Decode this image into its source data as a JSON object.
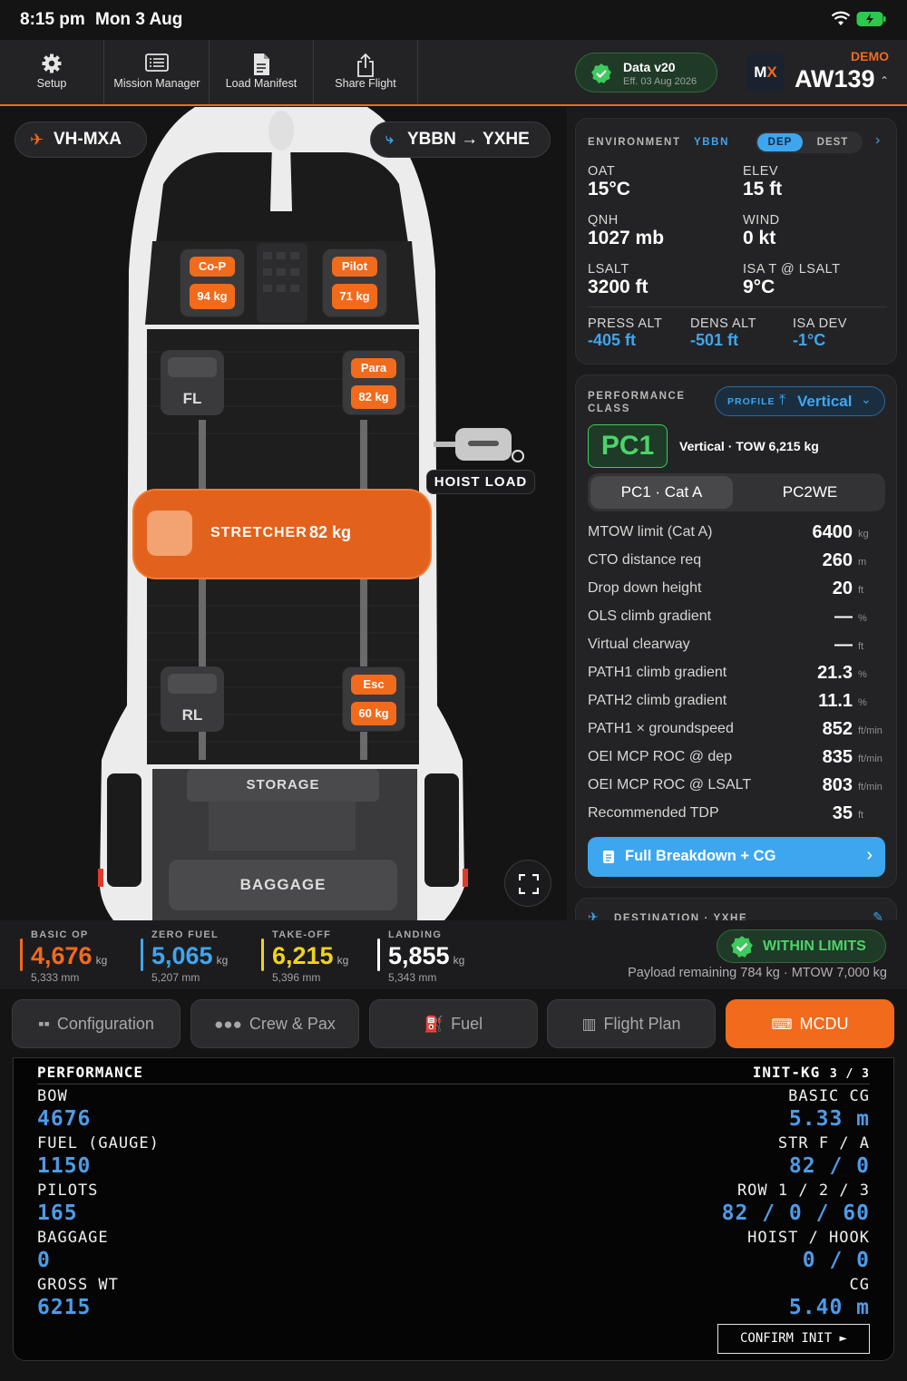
{
  "status": {
    "time": "8:15 pm",
    "date": "Mon 3 Aug"
  },
  "toolbar": {
    "buttons": [
      "Setup",
      "Mission Manager",
      "Load Manifest",
      "Share Flight"
    ],
    "data_version": "Data v20",
    "data_effective": "Eff. 03 Aug 2026",
    "logo_m": "M",
    "logo_x": "X",
    "demo": "DEMO",
    "aircraft": "AW139"
  },
  "heli": {
    "registration": "VH-MXA",
    "route": "YBBN → YXHE",
    "seats": {
      "copilot_label": "Co-P",
      "copilot_weight": "94 kg",
      "pilot_label": "Pilot",
      "pilot_weight": "71 kg",
      "fl_label": "FL",
      "para_label": "Para",
      "para_weight": "82 kg",
      "rl_label": "RL",
      "esc_label": "Esc",
      "esc_weight": "60 kg"
    },
    "hoist_label": "HOIST LOAD",
    "stretcher_label": "STRETCHER",
    "stretcher_weight": "82 kg",
    "storage_label": "STORAGE",
    "baggage_label": "BAGGAGE"
  },
  "environment": {
    "title": "ENVIRONMENT",
    "airport": "YBBN",
    "tab_dep": "DEP",
    "tab_dest": "DEST",
    "oat_label": "OAT",
    "oat": "15°C",
    "elev_label": "ELEV",
    "elev": "15 ft",
    "qnh_label": "QNH",
    "qnh": "1027 mb",
    "wind_label": "WIND",
    "wind": "0 kt",
    "lsalt_label": "LSALT",
    "lsalt": "3200 ft",
    "isa_label": "ISA T @ LSALT",
    "isa": "9°C",
    "press_label": "PRESS ALT",
    "press": "-405 ft",
    "dens_label": "DENS ALT",
    "dens": "-501 ft",
    "isadev_label": "ISA DEV",
    "isadev": "-1°C"
  },
  "performance": {
    "title_1": "PERFORMANCE",
    "title_2": "CLASS",
    "profile_label": "PROFILE",
    "profile_value": "Vertical",
    "class_badge": "PC1",
    "class_desc": "Vertical · TOW 6,215 kg",
    "seg_a": "PC1 · Cat A",
    "seg_b": "PC2WE",
    "rows": [
      {
        "label": "MTOW limit (Cat A)",
        "value": "6400",
        "unit": "kg"
      },
      {
        "label": "CTO distance req",
        "value": "260",
        "unit": "m"
      },
      {
        "label": "Drop down height",
        "value": "20",
        "unit": "ft"
      },
      {
        "label": "OLS climb gradient",
        "value": "—",
        "unit": "%"
      },
      {
        "label": "Virtual clearway",
        "value": "—",
        "unit": "ft"
      },
      {
        "label": "PATH1 climb gradient",
        "value": "21.3",
        "unit": "%"
      },
      {
        "label": "PATH2 climb gradient",
        "value": "11.1",
        "unit": "%"
      },
      {
        "label": "PATH1 × groundspeed",
        "value": "852",
        "unit": "ft/min"
      },
      {
        "label": "OEI MCP ROC @ dep",
        "value": "835",
        "unit": "ft/min"
      },
      {
        "label": "OEI MCP ROC @ LSALT",
        "value": "803",
        "unit": "ft/min"
      },
      {
        "label": "Recommended TDP",
        "value": "35",
        "unit": "ft"
      }
    ],
    "breakdown_button": "Full Breakdown + CG"
  },
  "destination_peek": "DESTINATION · YXHE",
  "weights": [
    {
      "label": "BASIC OP",
      "value": "4,676",
      "unit": "kg",
      "arm": "5,333 mm",
      "color": "#f26a1c"
    },
    {
      "label": "ZERO FUEL",
      "value": "5,065",
      "unit": "kg",
      "arm": "5,207 mm",
      "color": "#3ea6ef"
    },
    {
      "label": "TAKE-OFF",
      "value": "6,215",
      "unit": "kg",
      "arm": "5,396 mm",
      "color": "#f2d21c"
    },
    {
      "label": "LANDING",
      "value": "5,855",
      "unit": "kg",
      "arm": "5,343 mm",
      "color": "#ffffff"
    }
  ],
  "limits": {
    "status": "WITHIN LIMITS",
    "payload": "Payload remaining 784 kg · MTOW 7,000 kg"
  },
  "tabs": [
    "Configuration",
    "Crew & Pax",
    "Fuel",
    "Flight Plan",
    "MCDU"
  ],
  "mcdu": {
    "title": "PERFORMANCE",
    "page": "INIT-KG",
    "page_num": "3 / 3",
    "left": [
      {
        "key": "BOW",
        "val": "4676"
      },
      {
        "key": "FUEL (GAUGE)",
        "val": "1150"
      },
      {
        "key": "PILOTS",
        "val": "165"
      },
      {
        "key": "BAGGAGE",
        "val": "0"
      },
      {
        "key": "GROSS WT",
        "val": "6215"
      }
    ],
    "right": [
      {
        "key": "BASIC CG",
        "val": "5.33 m"
      },
      {
        "key": "STR F / A",
        "val": "82 / 0"
      },
      {
        "key": "ROW 1 / 2 / 3",
        "val": "82 / 0 / 60"
      },
      {
        "key": "HOIST / HOOK",
        "val": "0 / 0"
      },
      {
        "key": "CG",
        "val": "5.40 m"
      }
    ],
    "confirm": "CONFIRM INIT ►"
  }
}
